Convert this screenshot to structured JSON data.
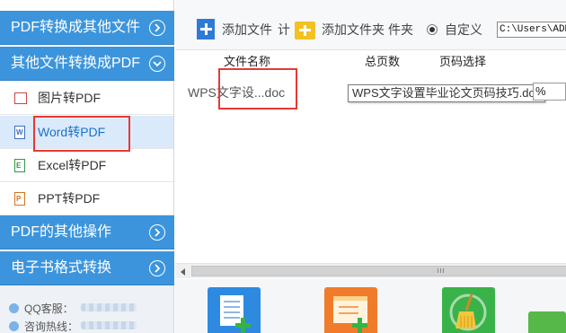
{
  "sidebar": {
    "section1": "PDF转换成其他文件",
    "section2": "其他文件转换成PDF",
    "items": [
      {
        "label": "图片转PDF",
        "icon": "image-file-icon"
      },
      {
        "label": "Word转PDF",
        "icon": "word-file-icon"
      },
      {
        "label": "Excel转PDF",
        "icon": "excel-file-icon"
      },
      {
        "label": "PPT转PDF",
        "icon": "ppt-file-icon"
      }
    ],
    "section3": "PDF的其他操作",
    "section4": "电子书格式转换",
    "contact": {
      "qq": "QQ客服：",
      "phone": "咨询热线："
    }
  },
  "toolbar": {
    "add_file": "添加文件",
    "add_file_overlap": "计",
    "add_folder": "添加文件夹",
    "add_folder_overlap": "件夹",
    "custom": "自定义",
    "path": "C:\\Users\\ADMI"
  },
  "filelist": {
    "headers": [
      "文件名称",
      "总页数",
      "页码选择"
    ],
    "row_name": "WPS文字设...doc",
    "tooltip": "WPS文字设置毕业论文页码技巧.doc",
    "progress_fragment": "%"
  },
  "scrollbar": {
    "grip": "III"
  },
  "colors": {
    "sidebar_header": "#3c95dc",
    "highlight": "#e53935",
    "active_item": "#dbeafb"
  }
}
